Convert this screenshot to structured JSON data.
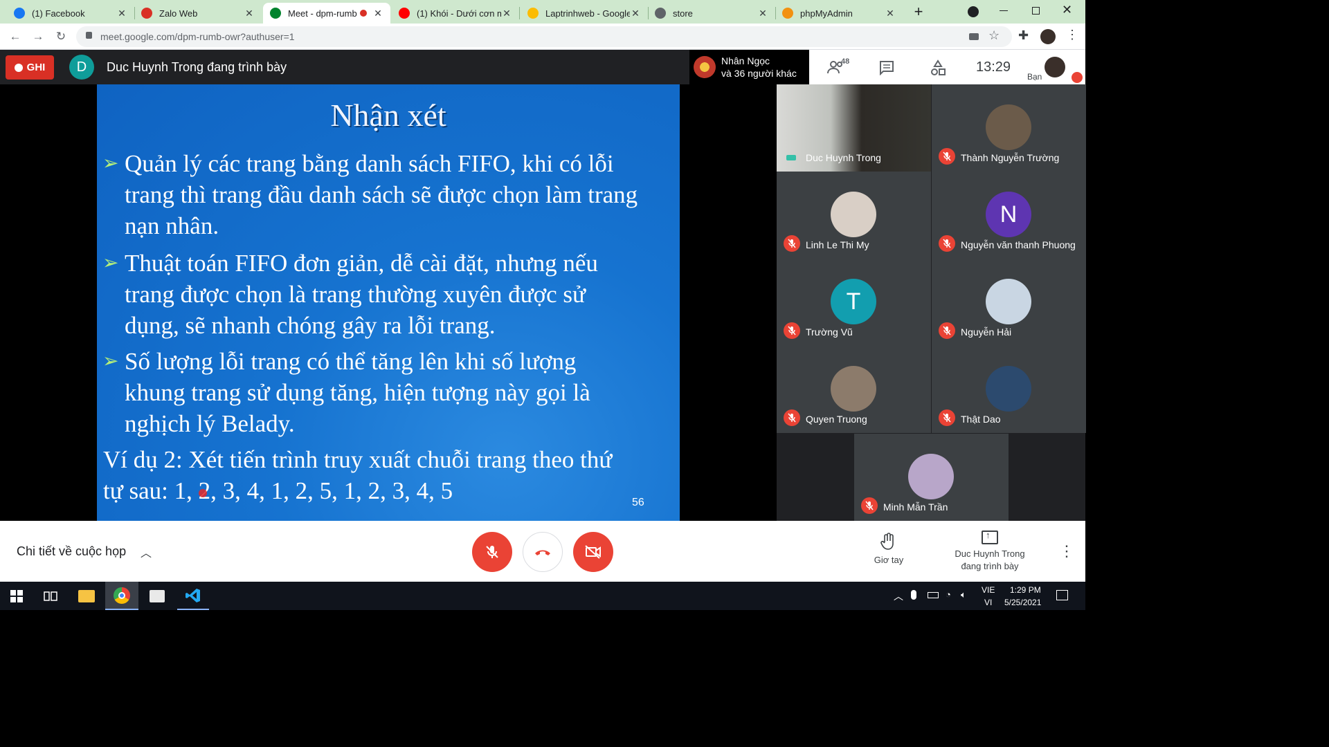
{
  "browser": {
    "tabs": [
      {
        "title": "(1) Facebook",
        "icon": "facebook-icon",
        "color": "#1877f2"
      },
      {
        "title": "Zalo Web",
        "icon": "zalo-icon",
        "color": "#d93025"
      },
      {
        "title": "Meet - dpm-rumb",
        "icon": "meet-icon",
        "color": "#00832d",
        "active": true
      },
      {
        "title": "(1) Khói - Dưới cơn m",
        "icon": "youtube-icon",
        "color": "#ff0000"
      },
      {
        "title": "Laptrinhweb - Google",
        "icon": "google-drive-icon",
        "color": "#fbbc04"
      },
      {
        "title": "store",
        "icon": "globe-icon",
        "color": "#5f6368"
      },
      {
        "title": "phpMyAdmin",
        "icon": "phpmyadmin-icon",
        "color": "#f29111"
      }
    ],
    "url": "meet.google.com/dpm-rumb-owr?authuser=1"
  },
  "meet": {
    "record_label": "GHI",
    "presenter_initial": "D",
    "presenter_text": "Duc Huynh Trong đang trình bày",
    "notification": {
      "line1": "Nhân Ngọc",
      "line2": "và 36 người khác"
    },
    "participant_count": "48",
    "clock": "13:29",
    "self_label": "Bạn"
  },
  "slide": {
    "title": "Nhận xét",
    "bullets": [
      [
        "Quản lý các trang bằng danh sách FIFO, khi có lỗi",
        "trang thì trang đầu danh sách sẽ được chọn làm trang",
        "nạn nhân."
      ],
      [
        "Thuật toán FIFO đơn giản, dễ cài đặt, nhưng nếu",
        "trang được chọn là trang thường xuyên được sử",
        "dụng, sẽ nhanh chóng gây ra lỗi trang."
      ],
      [
        "Số lượng lỗi trang có thể tăng lên khi số lượng",
        "khung trang sử dụng tăng, hiện tượng này gọi là",
        "nghịch lý Belady."
      ]
    ],
    "example": [
      "Ví dụ 2: Xét tiến trình truy xuất chuỗi trang theo thứ",
      "tự sau: 1, 2, 3, 4, 1, 2, 5, 1, 2, 3, 4, 5"
    ],
    "page_number": "56"
  },
  "participants": [
    {
      "name": "Duc Huynh Trong",
      "type": "video",
      "muted": false
    },
    {
      "name": "Thành Nguyễn Trường",
      "type": "photo",
      "color": "#6b5b4a",
      "muted": true
    },
    {
      "name": "Linh Le Thi My",
      "type": "photo",
      "color": "#d9cfc6",
      "muted": true
    },
    {
      "name": "Nguyễn văn thanh Phuong",
      "type": "initial",
      "initial": "N",
      "color": "#5e35b1",
      "muted": true
    },
    {
      "name": "Trường Vũ",
      "type": "initial",
      "initial": "T",
      "color": "#129eaf",
      "muted": true
    },
    {
      "name": "Nguyễn Hải",
      "type": "photo",
      "color": "#c9d6e3",
      "muted": true
    },
    {
      "name": "Quyen Truong",
      "type": "photo",
      "color": "#8c7b6b",
      "muted": true
    },
    {
      "name": "Thật Dao",
      "type": "photo",
      "color": "#2c4a6e",
      "muted": true
    },
    {
      "name": "Minh Mẫn Trần",
      "type": "photo",
      "color": "#b8a6c9",
      "muted": true
    }
  ],
  "bottom": {
    "details_label": "Chi tiết về cuộc họp",
    "raise_hand_label": "Giơ tay",
    "presenting_line1": "Duc Huynh Trong",
    "presenting_line2": "đang trình bày"
  },
  "taskbar": {
    "lang1": "VIE",
    "lang2": "VI",
    "time": "1:29 PM",
    "date": "5/25/2021"
  },
  "colors": {
    "accent_red": "#ea4335",
    "meet_dark": "#202124",
    "slide_blue": "#1673d0"
  }
}
